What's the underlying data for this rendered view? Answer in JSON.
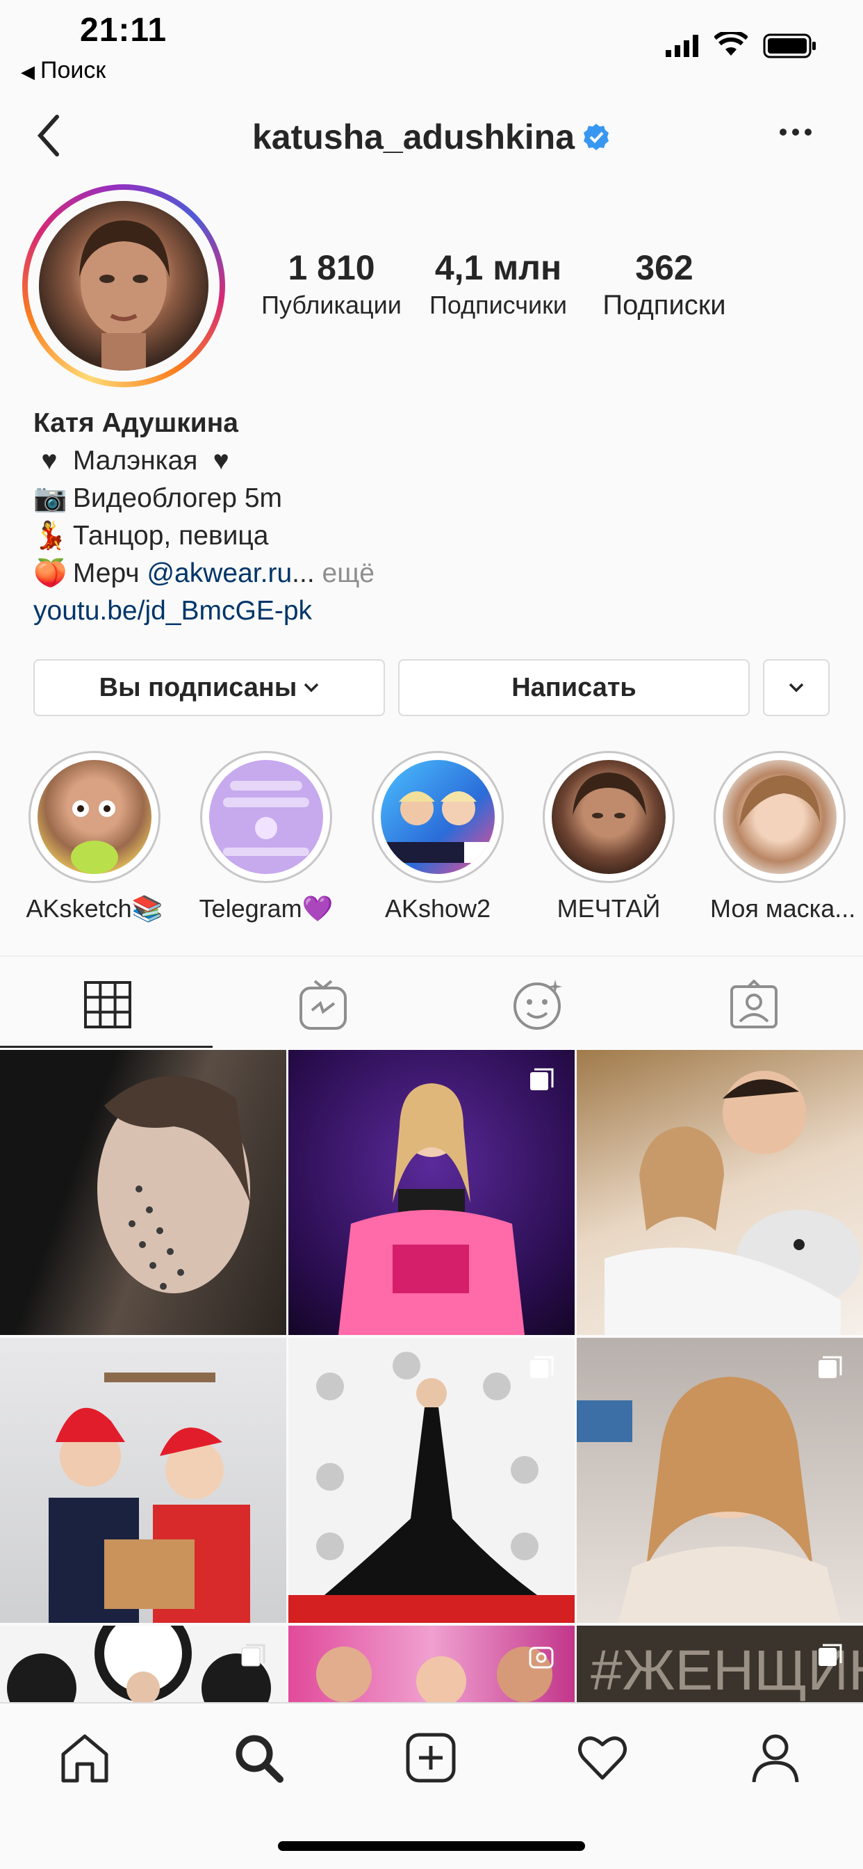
{
  "status_bar": {
    "time": "21:11",
    "back_app": "Поиск"
  },
  "header": {
    "username": "katusha_adushkina"
  },
  "stats": [
    {
      "value": "1 810",
      "label": "Публикации"
    },
    {
      "value": "4,1 млн",
      "label": "Подписчики"
    },
    {
      "value": "362",
      "label": "Подписки"
    }
  ],
  "bio": {
    "name": "Катя Адушкина",
    "line1": "Малэнкая",
    "line2": "Видеоблогер 5m",
    "line3": "Танцор, певица",
    "line4_prefix": "Мерч",
    "line4_link": "@akwear.ru",
    "line4_ellipsis": "...",
    "more": "ещё",
    "website": "youtu.be/jd_BmcGE-pk"
  },
  "actions": {
    "following": "Вы подписаны",
    "message": "Написать"
  },
  "highlights": [
    {
      "label": "AKsketch📚"
    },
    {
      "label": "Telegram💜"
    },
    {
      "label": "AKshow2"
    },
    {
      "label": "МЕЧТАЙ"
    },
    {
      "label": "Моя маска..."
    }
  ],
  "tabs": [
    "grid-icon",
    "igtv-icon",
    "reels-face-icon",
    "tagged-icon"
  ],
  "accent_colors": {
    "link": "#003569",
    "verified": "#3897f0"
  }
}
